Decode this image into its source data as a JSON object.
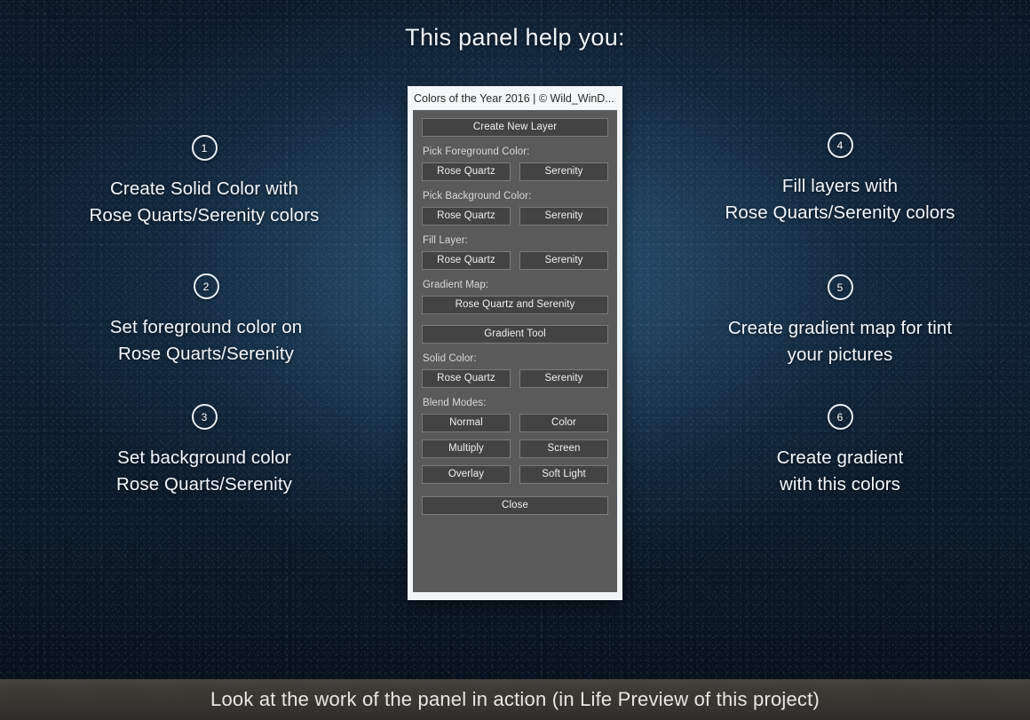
{
  "headline": "This panel help you:",
  "steps_left": [
    {
      "number": "1",
      "line1": "Create Solid Color with",
      "line2": "Rose Quarts/Serenity colors"
    },
    {
      "number": "2",
      "line1": "Set foreground color on",
      "line2": "Rose Quarts/Serenity"
    },
    {
      "number": "3",
      "line1": "Set background color",
      "line2": "Rose Quarts/Serenity"
    }
  ],
  "steps_right": [
    {
      "number": "4",
      "line1": "Fill layers with",
      "line2": "Rose Quarts/Serenity colors"
    },
    {
      "number": "5",
      "line1": "Create gradient map for tint",
      "line2": "your pictures"
    },
    {
      "number": "6",
      "line1": "Create gradient",
      "line2": "with this colors"
    }
  ],
  "panel": {
    "title": "Colors of the Year 2016 | © Wild_WinD...",
    "create_new_layer": "Create New Layer",
    "label_pick_foreground": "Pick Foreground Color:",
    "foreground": {
      "rose": "Rose Quartz",
      "serenity": "Serenity"
    },
    "label_pick_background": "Pick Background Color:",
    "background": {
      "rose": "Rose Quartz",
      "serenity": "Serenity"
    },
    "label_fill_layer": "Fill Layer:",
    "fill": {
      "rose": "Rose Quartz",
      "serenity": "Serenity"
    },
    "label_gradient_map": "Gradient Map:",
    "gradient_map_button": "Rose Quartz and Serenity",
    "gradient_tool_button": "Gradient Tool",
    "label_solid_color": "Solid Color:",
    "solid": {
      "rose": "Rose Quartz",
      "serenity": "Serenity"
    },
    "label_blend_modes": "Blend Modes:",
    "blend": {
      "normal": "Normal",
      "color": "Color",
      "multiply": "Multiply",
      "screen": "Screen",
      "overlay": "Overlay",
      "soft_light": "Soft Light"
    },
    "close": "Close"
  },
  "footer": {
    "text": "Look at the work of the panel in action   (in  Life Preview of this project)"
  },
  "colors": {
    "background_deep": "#081422",
    "background_glow": "#305c80",
    "panel_frame": "#f2f5f7",
    "panel_body": "#5a5a5a",
    "button_face": "#434343",
    "button_border": "#7b7b7b",
    "text_light": "#f0f0f0",
    "footer_bar": "#3b3733"
  }
}
